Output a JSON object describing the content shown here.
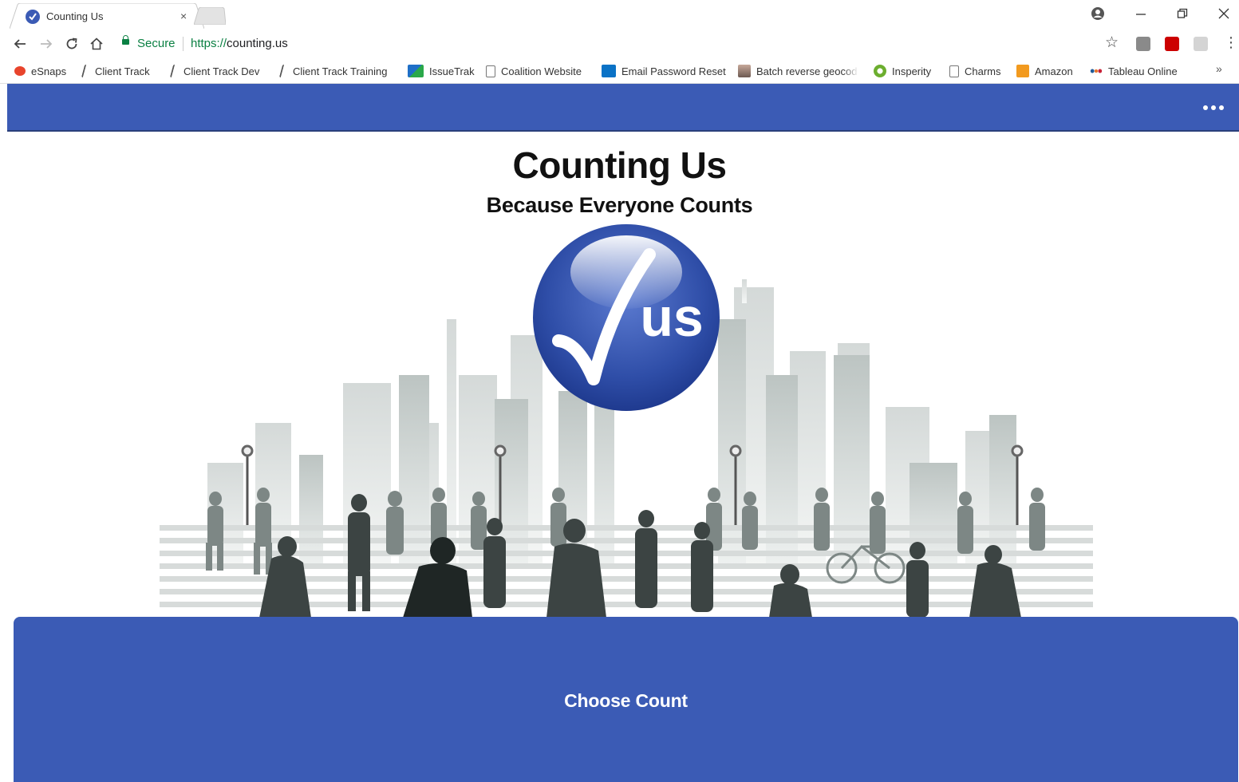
{
  "browser": {
    "tab": {
      "title": "Counting Us",
      "close_glyph": "×"
    },
    "omnibox": {
      "secure_label": "Secure",
      "scheme": "https://",
      "host": "counting.us"
    },
    "bookmarks": [
      {
        "label": "eSnaps",
        "icon": "esnaps-icon"
      },
      {
        "label": "Client Track",
        "icon": "client-track-icon"
      },
      {
        "label": "Client Track Dev",
        "icon": "client-track-icon"
      },
      {
        "label": "Client Track Training",
        "icon": "client-track-icon"
      },
      {
        "label": "IssueTrak",
        "icon": "issuetrak-icon"
      },
      {
        "label": "Coalition Website",
        "icon": "page-icon"
      },
      {
        "label": "Email Password Reset",
        "icon": "outlook-icon"
      },
      {
        "label": "Batch reverse geocod",
        "icon": "geocode-icon"
      },
      {
        "label": "Insperity",
        "icon": "insperity-icon"
      },
      {
        "label": "Charms",
        "icon": "page-icon"
      },
      {
        "label": "Amazon",
        "icon": "amazon-icon"
      },
      {
        "label": "Tableau Online",
        "icon": "tableau-icon"
      }
    ],
    "bookmarks_overflow": "»"
  },
  "app": {
    "title": "Counting Us",
    "subtitle": "Because Everyone Counts",
    "logo_text": "us",
    "cta_label": "Choose Count"
  },
  "colors": {
    "brand_blue": "#3b5bb5",
    "secure_green": "#0b8043"
  }
}
